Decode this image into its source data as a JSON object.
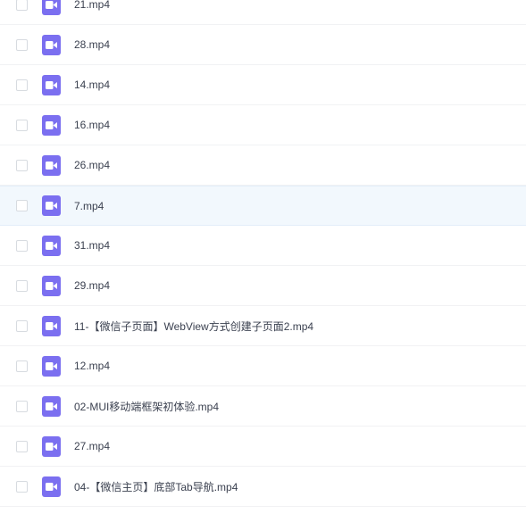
{
  "file_list": {
    "icon": "video-file-icon",
    "colors": {
      "icon_bg": "#7b6ff0",
      "row_highlight": "#f2f8fd",
      "text": "#3b4150"
    },
    "files": [
      {
        "name": "21.mp4"
      },
      {
        "name": "28.mp4"
      },
      {
        "name": "14.mp4"
      },
      {
        "name": "16.mp4"
      },
      {
        "name": "26.mp4"
      },
      {
        "name": "7.mp4"
      },
      {
        "name": "31.mp4"
      },
      {
        "name": "29.mp4"
      },
      {
        "name": "11-【微信子页面】WebView方式创建子页面2.mp4"
      },
      {
        "name": "12.mp4"
      },
      {
        "name": "02-MUI移动端框架初体验.mp4"
      },
      {
        "name": "27.mp4"
      },
      {
        "name": "04-【微信主页】底部Tab导航.mp4"
      }
    ]
  }
}
